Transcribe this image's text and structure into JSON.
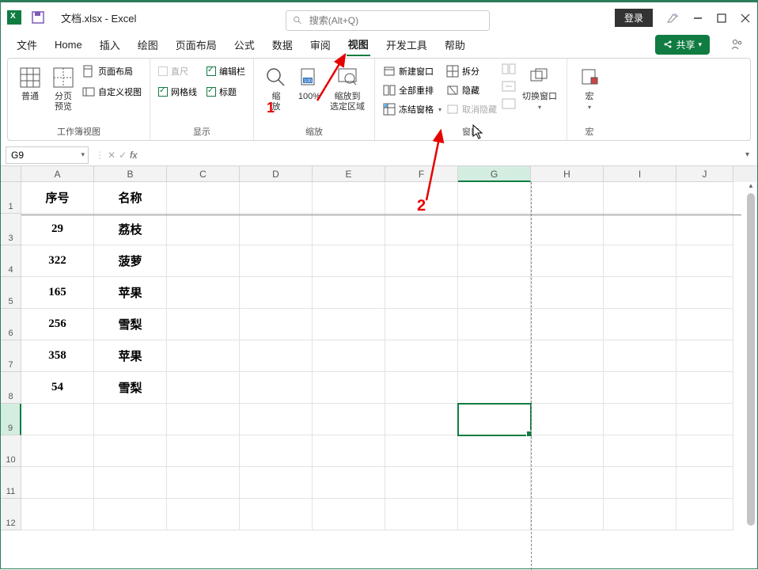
{
  "title": "文档.xlsx  -  Excel",
  "search_placeholder": "搜索(Alt+Q)",
  "login": "登录",
  "menu": {
    "file": "文件",
    "home": "Home",
    "insert": "插入",
    "draw": "绘图",
    "layout": "页面布局",
    "formulas": "公式",
    "data": "数据",
    "review": "审阅",
    "view": "视图",
    "dev": "开发工具",
    "help": "帮助"
  },
  "share": "共享",
  "ribbon": {
    "views": {
      "normal": "普通",
      "pagebreak": "分页\n预览",
      "pagelayout": "页面布局",
      "custom": "自定义视图",
      "group": "工作簿视图"
    },
    "show": {
      "ruler": "直尺",
      "gridlines": "网格线",
      "formulabar": "编辑栏",
      "headings": "标题",
      "group": "显示"
    },
    "zoom": {
      "zoom": "缩\n放",
      "hundred": "100%",
      "selection": "缩放到\n选定区域",
      "group": "缩放"
    },
    "window": {
      "new": "新建窗口",
      "arrange": "全部重排",
      "freeze": "冻结窗格",
      "split": "拆分",
      "hide": "隐藏",
      "unhide": "取消隐藏",
      "switch": "切换窗口",
      "group": "窗口"
    },
    "macros": {
      "macros": "宏",
      "group": "宏"
    }
  },
  "namebox": "G9",
  "colheads": [
    "A",
    "B",
    "C",
    "D",
    "E",
    "F",
    "G",
    "H",
    "I",
    "J"
  ],
  "data_rows": [
    {
      "rn": "1",
      "a": "序号",
      "b": "名称"
    },
    {
      "rn": "3",
      "a": "29",
      "b": "荔枝"
    },
    {
      "rn": "4",
      "a": "322",
      "b": "菠萝"
    },
    {
      "rn": "5",
      "a": "165",
      "b": "苹果"
    },
    {
      "rn": "6",
      "a": "256",
      "b": "雪梨"
    },
    {
      "rn": "7",
      "a": "358",
      "b": "苹果"
    },
    {
      "rn": "8",
      "a": "54",
      "b": "雪梨"
    }
  ],
  "empty_rows": [
    "9",
    "10",
    "11",
    "12"
  ],
  "annotations": {
    "one": "1",
    "two": "2"
  }
}
